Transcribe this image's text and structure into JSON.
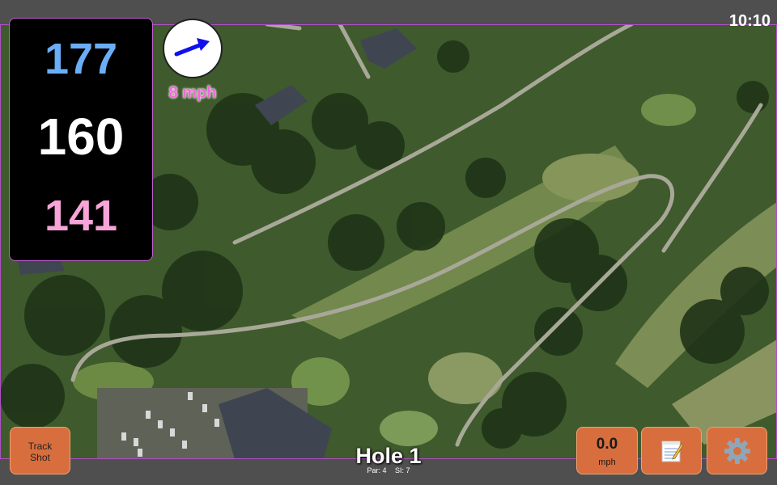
{
  "status_bar": {
    "time": "10:10"
  },
  "distances": {
    "back": "177",
    "middle": "160",
    "front": "141"
  },
  "wind": {
    "speed": "8 mph",
    "direction_icon": "arrow-right-icon"
  },
  "track_button": {
    "line1": "Track",
    "line2": "Shot"
  },
  "speed_button": {
    "value": "0.0",
    "unit": "mph"
  },
  "notes_button": {
    "icon": "notepad-icon"
  },
  "settings_button": {
    "icon": "gear-icon"
  },
  "hole": {
    "title": "Hole 1",
    "par": "Par: 4",
    "stroke_index": "SI: 7"
  },
  "colors": {
    "back": "#6aaef8",
    "middle": "#ffffff",
    "front": "#f7a4d8",
    "button": "#d86e3e",
    "wind": "#f06ad8"
  }
}
